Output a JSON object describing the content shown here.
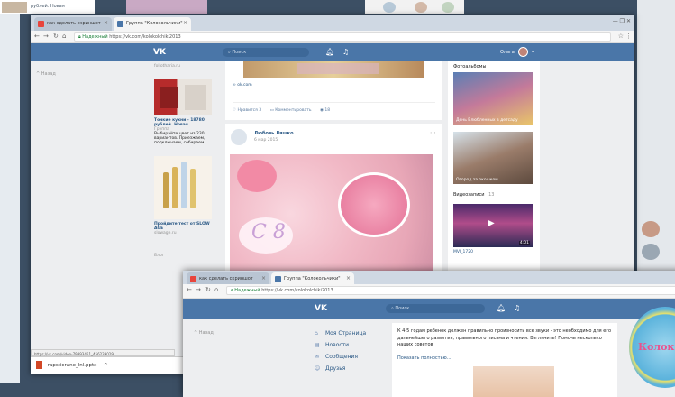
{
  "bg_top": {
    "fragment_text": "рублей. Новая"
  },
  "window1": {
    "tabs": [
      {
        "label": "как сделать скриншот",
        "active": false
      },
      {
        "label": "Группа \"Колокольчики\"",
        "active": true
      }
    ],
    "close_glyph": "×",
    "address": {
      "secure_label": "Надежный",
      "url": "https://vk.com/kolokolchiki2013"
    },
    "header": {
      "logo": "VK",
      "search_placeholder": "Поиск",
      "user_name": "Ольга"
    },
    "sidebar_left": {
      "item": "Назад"
    },
    "ads": [
      {
        "site": "follotharia.ru",
        "title": "Тонкие кухни - 18780 рублей. Новая",
        "subtitle": "Группа",
        "text": "Выбирайте цвет из 230 вариантов. Приезжаем, подключаем, собираем."
      },
      {
        "title": "Пройдите тест от SLOW AGE",
        "site": "slowage.ru"
      }
    ],
    "ads_footer": "Блог",
    "post1": {
      "source": "ok.com",
      "like_label": "Нравится",
      "like_count": "3",
      "comment_label": "Комментировать",
      "views": "18"
    },
    "post2": {
      "author": "Любовь Ляшко",
      "date": "6 мар 2015",
      "card_text": "С 8"
    },
    "right_col": {
      "albums_title": "Фотоальбомы",
      "photos": [
        {
          "caption": "День Влюбленных в детсаду"
        },
        {
          "caption": "Огород за окошком"
        }
      ],
      "videos_title": "Видеозаписи",
      "videos_count": "13",
      "video": {
        "duration": "4:01",
        "caption": "MVI_1720"
      }
    },
    "status_url": "https://vk.com/video-79393451_456239029",
    "download_file": "rapsticrane_lnl.pptx",
    "download_arrow": "^"
  },
  "window2": {
    "tabs": [
      {
        "label": "как сделать скриншот"
      },
      {
        "label": "Группа \"Колокольчики\""
      }
    ],
    "close_glyph": "×",
    "address": {
      "secure_label": "Надежный",
      "url": "https://vk.com/kolokolchiki2013"
    },
    "header": {
      "logo": "VK",
      "search_placeholder": "Поиск"
    },
    "sidebar_left": {
      "item": "Назад"
    },
    "menu": [
      {
        "label": "Моя Страница",
        "icon": "⌂"
      },
      {
        "label": "Новости",
        "icon": "▤"
      },
      {
        "label": "Сообщения",
        "icon": "✉"
      },
      {
        "label": "Друзья",
        "icon": "☺"
      }
    ],
    "post_text": "К 4-5 годам ребенок должен правильно произносить все звуки - это необходимо для его дальнейшего развития, правильного письма и чтения. Взгляните! Помочь несколько наших советов",
    "show_more": "Показать полностью...",
    "logo_text": "Колок"
  }
}
